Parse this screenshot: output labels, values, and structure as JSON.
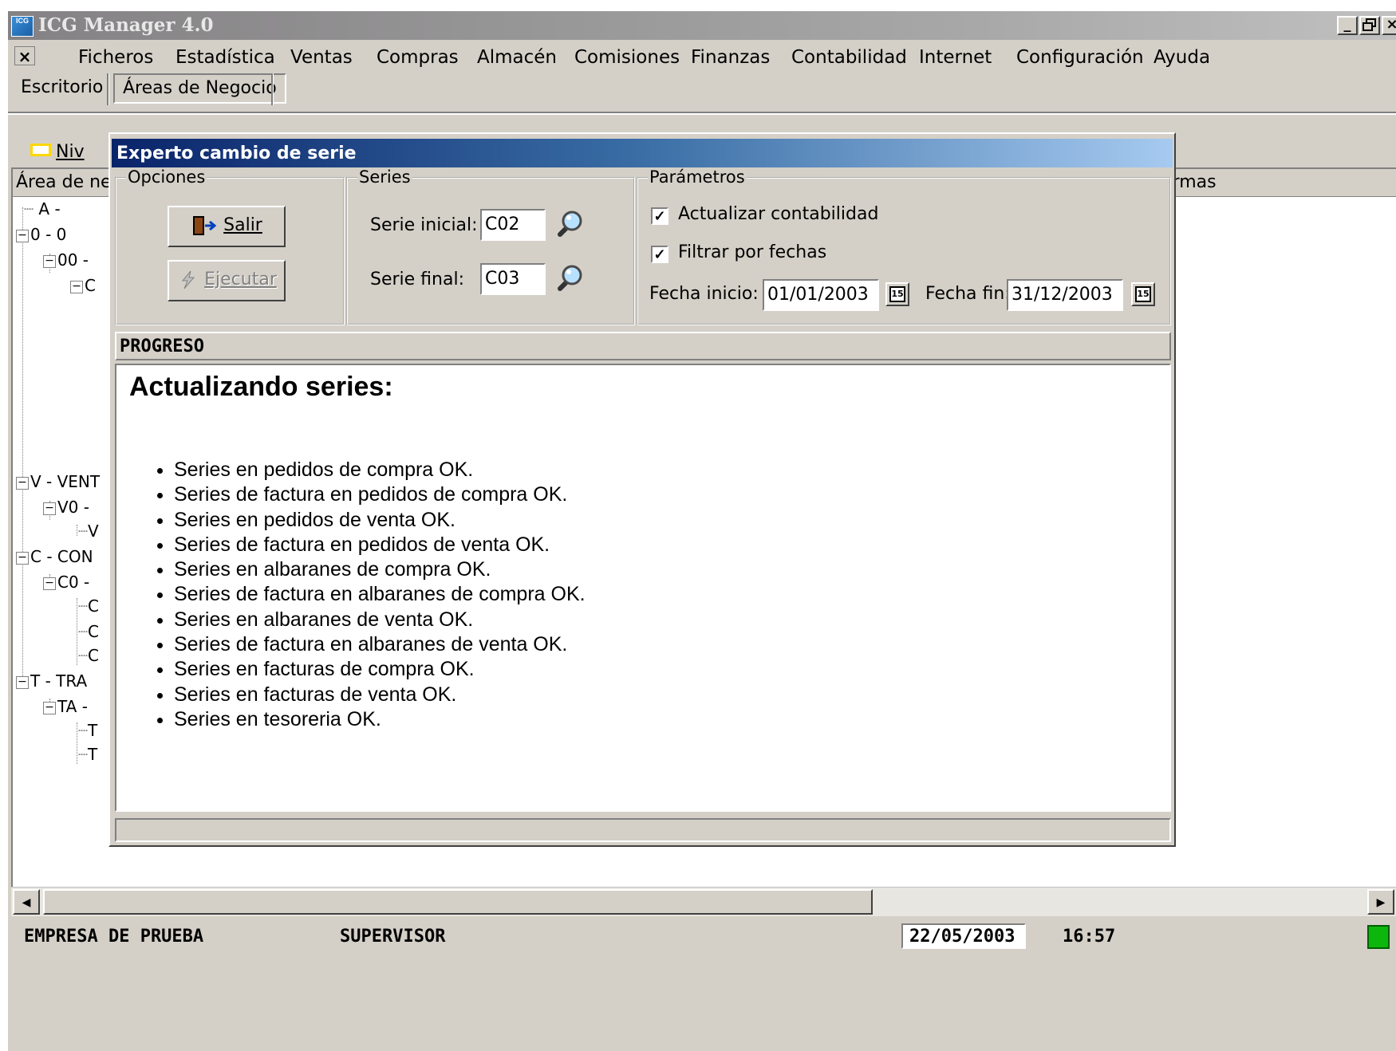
{
  "window": {
    "title": "ICG Manager 4.0",
    "icon_text": "ICG",
    "minimize": "_",
    "restore": " ",
    "close": "×"
  },
  "menu": {
    "mdi_close": "×",
    "items": [
      "Ficheros",
      "Estadística",
      "Ventas",
      "Compras",
      "Almacén",
      "Comisiones",
      "Finanzas",
      "Contabilidad",
      "Internet",
      "Configuración",
      "Ayuda"
    ]
  },
  "tabs": {
    "escritorio": "Escritorio",
    "areas": "Áreas de Negocio"
  },
  "background": {
    "toolbar_label": "Niv",
    "grid_header_left": "Área de ne",
    "grid_header_right": "ermas",
    "tree": [
      "A -",
      "0 - 0",
      "00 -",
      "C",
      "V - VENT",
      "V0 -",
      "V",
      "C - CON",
      "C0 -",
      "C",
      "C",
      "C",
      "T - TRA",
      "TA -",
      "T",
      "T"
    ]
  },
  "dialog": {
    "title": "Experto cambio de serie",
    "opciones": {
      "legend": "Opciones",
      "salir": "Salir",
      "ejecutar": "Ejecutar"
    },
    "series": {
      "legend": "Series",
      "inicial_label": "Serie inicial:",
      "inicial_value": "C02",
      "final_label": "Serie final:",
      "final_value": "C03"
    },
    "parametros": {
      "legend": "Parámetros",
      "actualizar_label": "Actualizar contabilidad",
      "actualizar_checked": true,
      "filtrar_label": "Filtrar por fechas",
      "filtrar_checked": true,
      "fecha_inicio_label": "Fecha inicio:",
      "fecha_inicio_value": "01/01/2003",
      "fecha_fin_label": "Fecha fin:",
      "fecha_fin_value": "31/12/2003",
      "cal_icon_text": "15"
    },
    "progress": {
      "header": "PROGRESO",
      "title": "Actualizando series:",
      "items": [
        "Series en pedidos de compra  OK.",
        "Series de factura en pedidos de compra  OK.",
        "Series en pedidos de venta  OK.",
        "Series de factura en pedidos de venta  OK.",
        "Series en albaranes de compra  OK.",
        "Series de factura en albaranes de compra  OK.",
        "Series en albaranes de venta  OK.",
        "Series de factura en albaranes de venta  OK.",
        "Series en facturas de compra  OK.",
        "Series en facturas de venta  OK.",
        "Series en tesoreria  OK."
      ]
    }
  },
  "statusbar": {
    "empresa": "EMPRESA DE PRUEBA",
    "usuario": "SUPERVISOR",
    "fecha": "22/05/2003",
    "hora": "16:57",
    "led_color": "#0db60d"
  },
  "scrollbar": {
    "left_arrow": "◀",
    "right_arrow": "▶"
  }
}
